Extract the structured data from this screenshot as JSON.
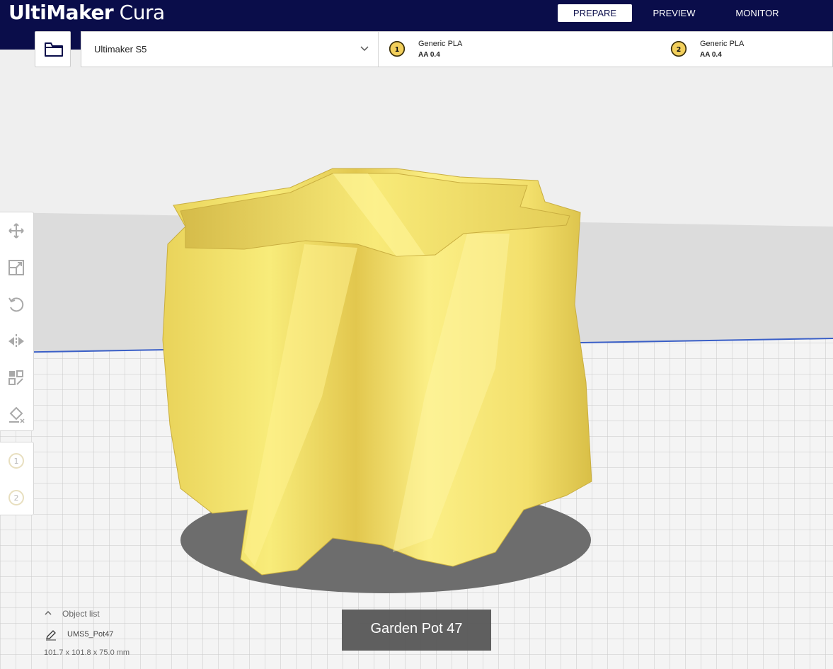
{
  "app": {
    "brand_bold": "UltiMaker",
    "brand_light": "Cura"
  },
  "stages": [
    {
      "label": "PREPARE",
      "active": true
    },
    {
      "label": "PREVIEW",
      "active": false
    },
    {
      "label": "MONITOR",
      "active": false
    }
  ],
  "machine": {
    "name": "Ultimaker S5"
  },
  "extruders": [
    {
      "index": "1",
      "material": "Generic PLA",
      "core": "AA 0.4"
    },
    {
      "index": "2",
      "material": "Generic PLA",
      "core": "AA 0.4"
    }
  ],
  "tools": [
    "move-icon",
    "scale-icon",
    "rotate-icon",
    "mirror-icon",
    "per-model-settings-icon",
    "support-blocker-icon"
  ],
  "extruder_tools": [
    "1",
    "2"
  ],
  "object_list": {
    "header": "Object list",
    "item": "UMS5_Pot47",
    "dimensions": "101.7 x 101.8 x 75.0 mm"
  },
  "caption": "Garden Pot 47",
  "colors": {
    "topbar": "#0a0d4a",
    "model": "#f5e36a",
    "extruder_badge": "#f2cf5b"
  }
}
